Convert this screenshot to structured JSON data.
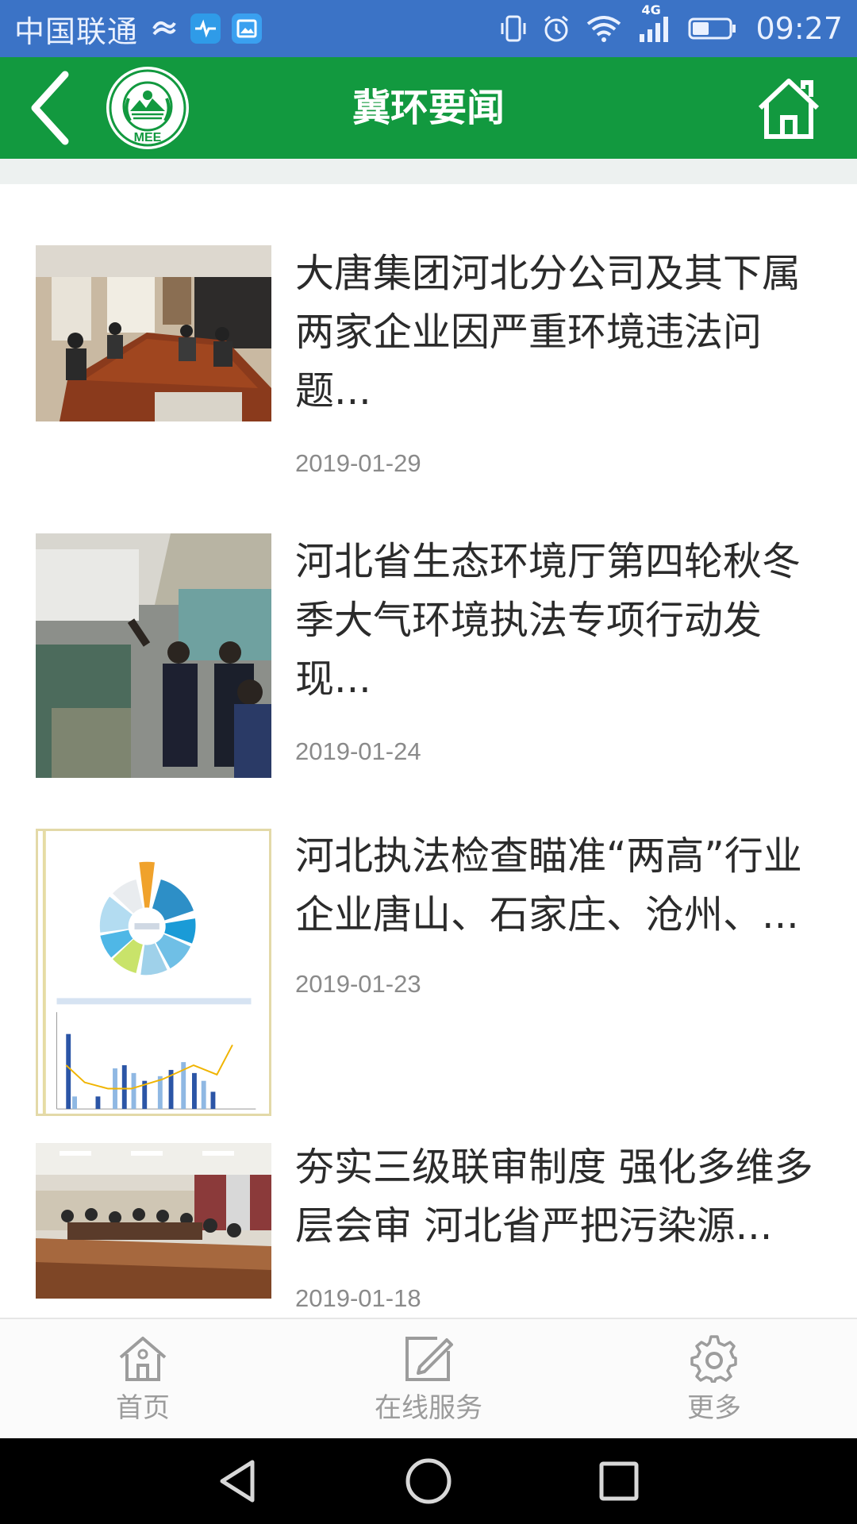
{
  "status_bar": {
    "carrier": "中国联通",
    "time": "09:27",
    "network": "4G"
  },
  "app_bar": {
    "title": "冀环要闻",
    "logo_text": "MEE"
  },
  "news": [
    {
      "title": "大唐集团河北分公司及其下属两家企业因严重环境违法问题...",
      "date": "2019-01-29",
      "thumb": "meeting-room-photo"
    },
    {
      "title": "河北省生态环境厅第四轮秋冬季大气环境执法专项行动发现...",
      "date": "2019-01-24",
      "thumb": "factory-inspection-photo"
    },
    {
      "title": "河北执法检查瞄准“两高”行业企业唐山、石家庄、沧州、...",
      "date": "2019-01-23",
      "thumb": "infographic-chart"
    },
    {
      "title": "夯实三级联审制度 强化多维多层会审 河北省严把污染源...",
      "date": "2019-01-18",
      "thumb": "conference-hall-photo"
    }
  ],
  "bottom_nav": [
    {
      "label": "首页",
      "icon": "home-icon"
    },
    {
      "label": "在线服务",
      "icon": "edit-icon"
    },
    {
      "label": "更多",
      "icon": "gear-icon"
    }
  ],
  "colors": {
    "status_bar": "#3b73c6",
    "app_bar": "#12993f",
    "nav_gray": "#9c9c9c"
  }
}
